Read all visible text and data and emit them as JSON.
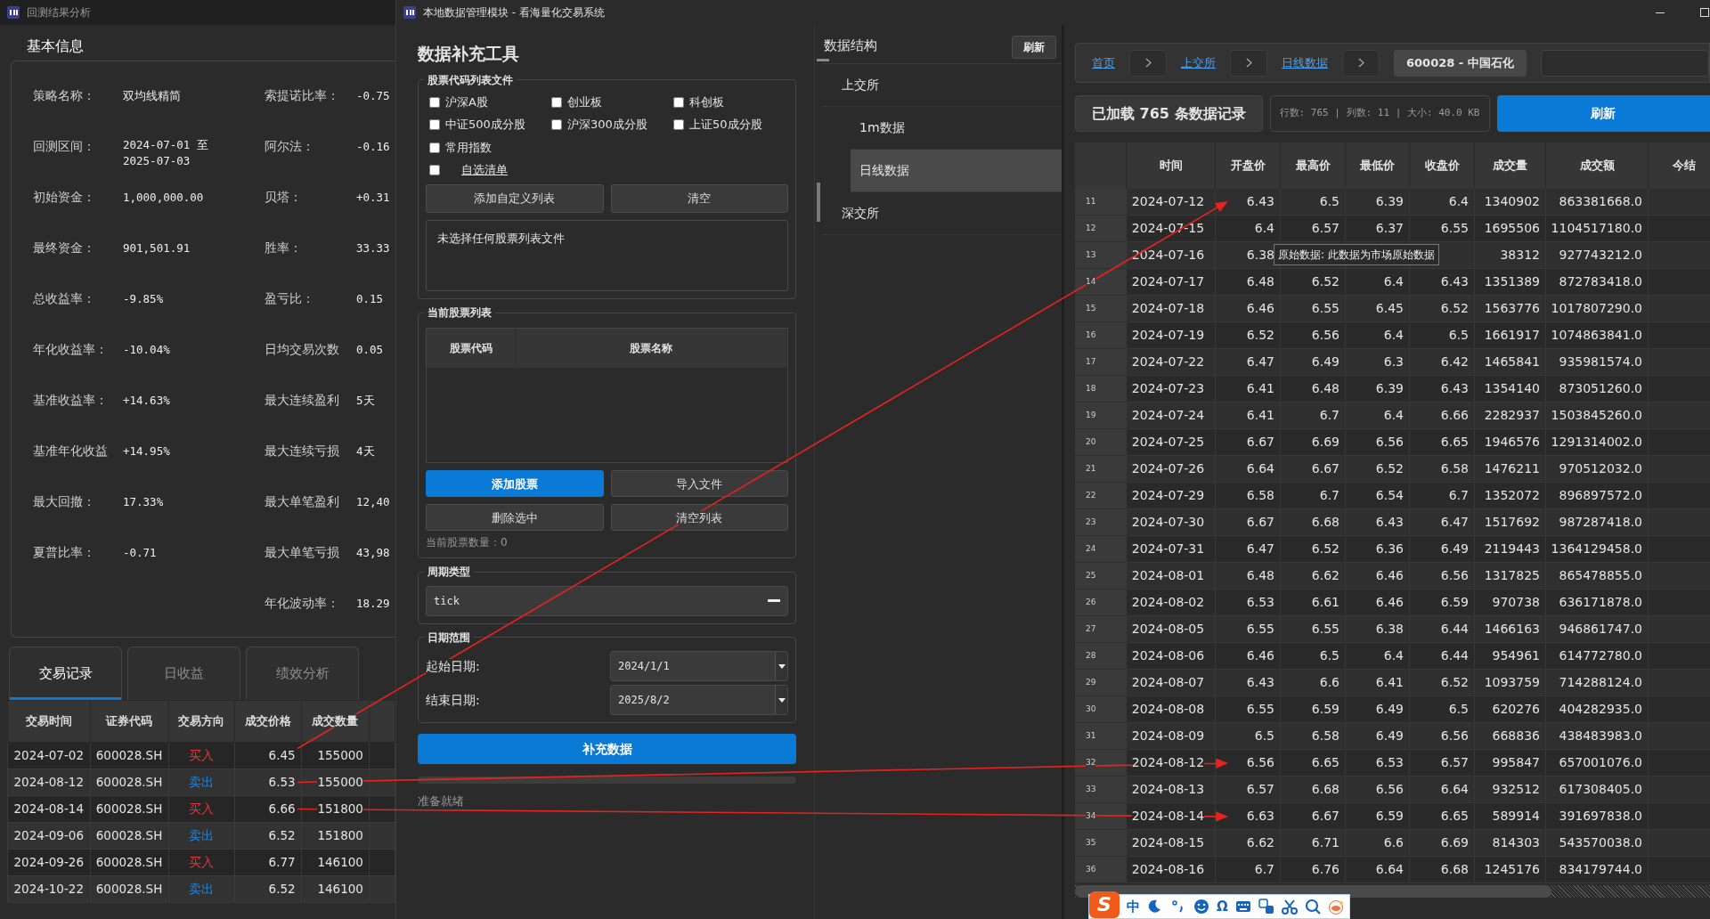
{
  "analysis_window": {
    "title": "回测结果分析",
    "section_title": "基本信息",
    "info_left": [
      {
        "label": "策略名称：",
        "value": "双均线精简"
      },
      {
        "label": "回测区间：",
        "value": "2024-07-01 至 2025-07-03"
      },
      {
        "label": "初始资金：",
        "value": "1,000,000.00"
      },
      {
        "label": "最终资金：",
        "value": "901,501.91"
      },
      {
        "label": "总收益率：",
        "value": "-9.85%"
      },
      {
        "label": "年化收益率：",
        "value": "-10.04%"
      },
      {
        "label": "基准收益率：",
        "value": "+14.63%"
      },
      {
        "label": "基准年化收益",
        "value": "+14.95%"
      },
      {
        "label": "最大回撤：",
        "value": "17.33%"
      },
      {
        "label": "夏普比率：",
        "value": "-0.71"
      }
    ],
    "info_right": [
      {
        "label": "索提诺比率：",
        "value": "-0.75"
      },
      {
        "label": "阿尔法：",
        "value": "-0.16"
      },
      {
        "label": "贝塔：",
        "value": "+0.31"
      },
      {
        "label": "胜率：",
        "value": "33.33"
      },
      {
        "label": "盈亏比：",
        "value": "0.15"
      },
      {
        "label": "日均交易次数",
        "value": "0.05"
      },
      {
        "label": "最大连续盈利",
        "value": "5天"
      },
      {
        "label": "最大连续亏损",
        "value": "4天"
      },
      {
        "label": "最大单笔盈利",
        "value": "12,40"
      },
      {
        "label": "最大单笔亏损",
        "value": "43,98"
      },
      {
        "label": "年化波动率：",
        "value": "18.29"
      }
    ],
    "tabs": [
      {
        "label": "交易记录",
        "selected": true
      },
      {
        "label": "日收益",
        "selected": false
      },
      {
        "label": "绩效分析",
        "selected": false
      }
    ],
    "trades": {
      "columns": [
        "交易时间",
        "证券代码",
        "交易方向",
        "成交价格",
        "成交数量"
      ],
      "rows": [
        {
          "time": "2024-07-02",
          "code": "600028.SH",
          "direction": "买入",
          "kind": "buy",
          "price": "6.45",
          "qty": "155000"
        },
        {
          "time": "2024-08-12",
          "code": "600028.SH",
          "direction": "卖出",
          "kind": "sell",
          "price": "6.53",
          "qty": "155000"
        },
        {
          "time": "2024-08-14",
          "code": "600028.SH",
          "direction": "买入",
          "kind": "buy",
          "price": "6.66",
          "qty": "151800"
        },
        {
          "time": "2024-09-06",
          "code": "600028.SH",
          "direction": "卖出",
          "kind": "sell",
          "price": "6.52",
          "qty": "151800"
        },
        {
          "time": "2024-09-26",
          "code": "600028.SH",
          "direction": "买入",
          "kind": "buy",
          "price": "6.77",
          "qty": "146100"
        },
        {
          "time": "2024-10-22",
          "code": "600028.SH",
          "direction": "卖出",
          "kind": "sell",
          "price": "6.52",
          "qty": "146100"
        }
      ]
    }
  },
  "data_window": {
    "title": "本地数据管理模块 - 看海量化交易系统",
    "tool": {
      "title": "数据补充工具",
      "list_group": {
        "legend": "股票代码列表文件",
        "checkboxes": [
          {
            "label": "沪深A股",
            "checked": false,
            "kind": "plain"
          },
          {
            "label": "创业板",
            "checked": false,
            "kind": "plain"
          },
          {
            "label": "科创板",
            "checked": false,
            "kind": "plain"
          },
          {
            "label": "中证500成分股",
            "checked": false,
            "kind": "plain"
          },
          {
            "label": "沪深300成分股",
            "checked": false,
            "kind": "plain"
          },
          {
            "label": "上证50成分股",
            "checked": false,
            "kind": "plain"
          },
          {
            "label": "常用指数",
            "checked": false,
            "kind": "plain"
          },
          {
            "label": "自选清单",
            "checked": false,
            "kind": "link"
          }
        ],
        "buttons": [
          "添加自定义列表",
          "清空"
        ],
        "file_box": "未选择任何股票列表文件"
      },
      "stock_group": {
        "legend": "当前股票列表",
        "columns": [
          "股票代码",
          "股票名称"
        ],
        "buttons": [
          {
            "label": "添加股票",
            "primary": true
          },
          {
            "label": "导入文件",
            "primary": false
          },
          {
            "label": "删除选中",
            "primary": false
          },
          {
            "label": "清空列表",
            "primary": false
          }
        ],
        "count": "当前股票数量：0"
      },
      "period_group": {
        "legend": "周期类型",
        "value": "tick"
      },
      "date_group": {
        "legend": "日期范围",
        "fields": [
          {
            "label": "起始日期:",
            "value": "2024/1/1"
          },
          {
            "label": "结束日期:",
            "value": "2025/8/2"
          }
        ]
      },
      "run_button": "补充数据",
      "progress": {
        "level": 0
      },
      "status": "准备就绪"
    },
    "tree": {
      "title": "数据结构",
      "refresh": "刷新",
      "items": [
        {
          "label": "上交所",
          "selected": false,
          "children": [
            {
              "label": "1m数据",
              "selected": false
            },
            {
              "label": "日线数据",
              "selected": true
            }
          ]
        },
        {
          "label": "深交所",
          "selected": false
        }
      ]
    },
    "viewer": {
      "breadcrumb": {
        "links": [
          "首页",
          "上交所",
          "日线数据"
        ],
        "current": "600028 - 中国石化"
      },
      "summary": "已加载 765 条数据记录",
      "stats": "行数: 765 | 列数: 11 | 大小: 40.0 KB",
      "refresh": "刷新",
      "tooltip": "原始数据: 此数据为市场原始数据",
      "table": {
        "columns": [
          "时间",
          "开盘价",
          "最高价",
          "最低价",
          "收盘价",
          "成交量",
          "成交额",
          "今结"
        ],
        "rows": [
          {
            "n": "11",
            "cells": [
              "2024-07-12",
              "6.43",
              "6.5",
              "6.39",
              "6.4",
              "1340902",
              "863381668.0"
            ]
          },
          {
            "n": "12",
            "cells": [
              "2024-07-15",
              "6.4",
              "6.57",
              "6.37",
              "6.55",
              "1695506",
              "1104517180.0"
            ]
          },
          {
            "n": "13",
            "cells": [
              "2024-07-16",
              "6.38",
              null,
              null,
              null,
              "38312",
              "927743212.0"
            ]
          },
          {
            "n": "14",
            "cells": [
              "2024-07-17",
              "6.48",
              "6.52",
              "6.4",
              "6.43",
              "1351389",
              "872783418.0"
            ]
          },
          {
            "n": "15",
            "cells": [
              "2024-07-18",
              "6.46",
              "6.55",
              "6.45",
              "6.52",
              "1563776",
              "1017807290.0"
            ]
          },
          {
            "n": "16",
            "cells": [
              "2024-07-19",
              "6.52",
              "6.56",
              "6.4",
              "6.5",
              "1661917",
              "1074863841.0"
            ]
          },
          {
            "n": "17",
            "cells": [
              "2024-07-22",
              "6.47",
              "6.49",
              "6.3",
              "6.42",
              "1465841",
              "935981574.0"
            ]
          },
          {
            "n": "18",
            "cells": [
              "2024-07-23",
              "6.41",
              "6.48",
              "6.39",
              "6.43",
              "1354140",
              "873051260.0"
            ]
          },
          {
            "n": "19",
            "cells": [
              "2024-07-24",
              "6.41",
              "6.7",
              "6.4",
              "6.66",
              "2282937",
              "1503845260.0"
            ]
          },
          {
            "n": "20",
            "cells": [
              "2024-07-25",
              "6.67",
              "6.69",
              "6.56",
              "6.65",
              "1946576",
              "1291314002.0"
            ]
          },
          {
            "n": "21",
            "cells": [
              "2024-07-26",
              "6.64",
              "6.67",
              "6.52",
              "6.58",
              "1476211",
              "970512032.0"
            ]
          },
          {
            "n": "22",
            "cells": [
              "2024-07-29",
              "6.58",
              "6.7",
              "6.54",
              "6.7",
              "1352072",
              "896897572.0"
            ]
          },
          {
            "n": "23",
            "cells": [
              "2024-07-30",
              "6.67",
              "6.68",
              "6.43",
              "6.47",
              "1517692",
              "987287418.0"
            ]
          },
          {
            "n": "24",
            "cells": [
              "2024-07-31",
              "6.47",
              "6.52",
              "6.36",
              "6.49",
              "2119443",
              "1364129458.0"
            ]
          },
          {
            "n": "25",
            "cells": [
              "2024-08-01",
              "6.48",
              "6.62",
              "6.46",
              "6.56",
              "1317825",
              "865478855.0"
            ]
          },
          {
            "n": "26",
            "cells": [
              "2024-08-02",
              "6.53",
              "6.61",
              "6.46",
              "6.59",
              "970738",
              "636171878.0"
            ]
          },
          {
            "n": "27",
            "cells": [
              "2024-08-05",
              "6.55",
              "6.55",
              "6.38",
              "6.44",
              "1466163",
              "946861747.0"
            ]
          },
          {
            "n": "28",
            "cells": [
              "2024-08-06",
              "6.46",
              "6.5",
              "6.4",
              "6.44",
              "954961",
              "614772780.0"
            ]
          },
          {
            "n": "29",
            "cells": [
              "2024-08-07",
              "6.43",
              "6.6",
              "6.41",
              "6.52",
              "1093759",
              "714288124.0"
            ]
          },
          {
            "n": "30",
            "cells": [
              "2024-08-08",
              "6.55",
              "6.59",
              "6.49",
              "6.5",
              "620276",
              "404282935.0"
            ]
          },
          {
            "n": "31",
            "cells": [
              "2024-08-09",
              "6.5",
              "6.58",
              "6.49",
              "6.56",
              "668836",
              "438483983.0"
            ]
          },
          {
            "n": "32",
            "cells": [
              "2024-08-12",
              "6.56",
              "6.65",
              "6.53",
              "6.57",
              "995847",
              "657001076.0"
            ]
          },
          {
            "n": "33",
            "cells": [
              "2024-08-13",
              "6.57",
              "6.68",
              "6.56",
              "6.64",
              "932512",
              "617308405.0"
            ]
          },
          {
            "n": "34",
            "cells": [
              "2024-08-14",
              "6.63",
              "6.67",
              "6.59",
              "6.65",
              "589914",
              "391697838.0"
            ]
          },
          {
            "n": "35",
            "cells": [
              "2024-08-15",
              "6.62",
              "6.71",
              "6.6",
              "6.69",
              "814303",
              "543570038.0"
            ]
          },
          {
            "n": "36",
            "cells": [
              "2024-08-16",
              "6.7",
              "6.76",
              "6.64",
              "6.68",
              "1245176",
              "834179744.0"
            ]
          }
        ]
      }
    }
  },
  "ime_toolbar": {
    "items": [
      {
        "kind": "logo",
        "text": "S"
      },
      {
        "kind": "text",
        "text": "中"
      },
      {
        "kind": "moon"
      },
      {
        "kind": "punct"
      },
      {
        "kind": "smile"
      },
      {
        "kind": "text",
        "text": "Ω"
      },
      {
        "kind": "keyboard"
      },
      {
        "kind": "translate"
      },
      {
        "kind": "scissors"
      },
      {
        "kind": "search"
      },
      {
        "kind": "mascot"
      }
    ]
  }
}
